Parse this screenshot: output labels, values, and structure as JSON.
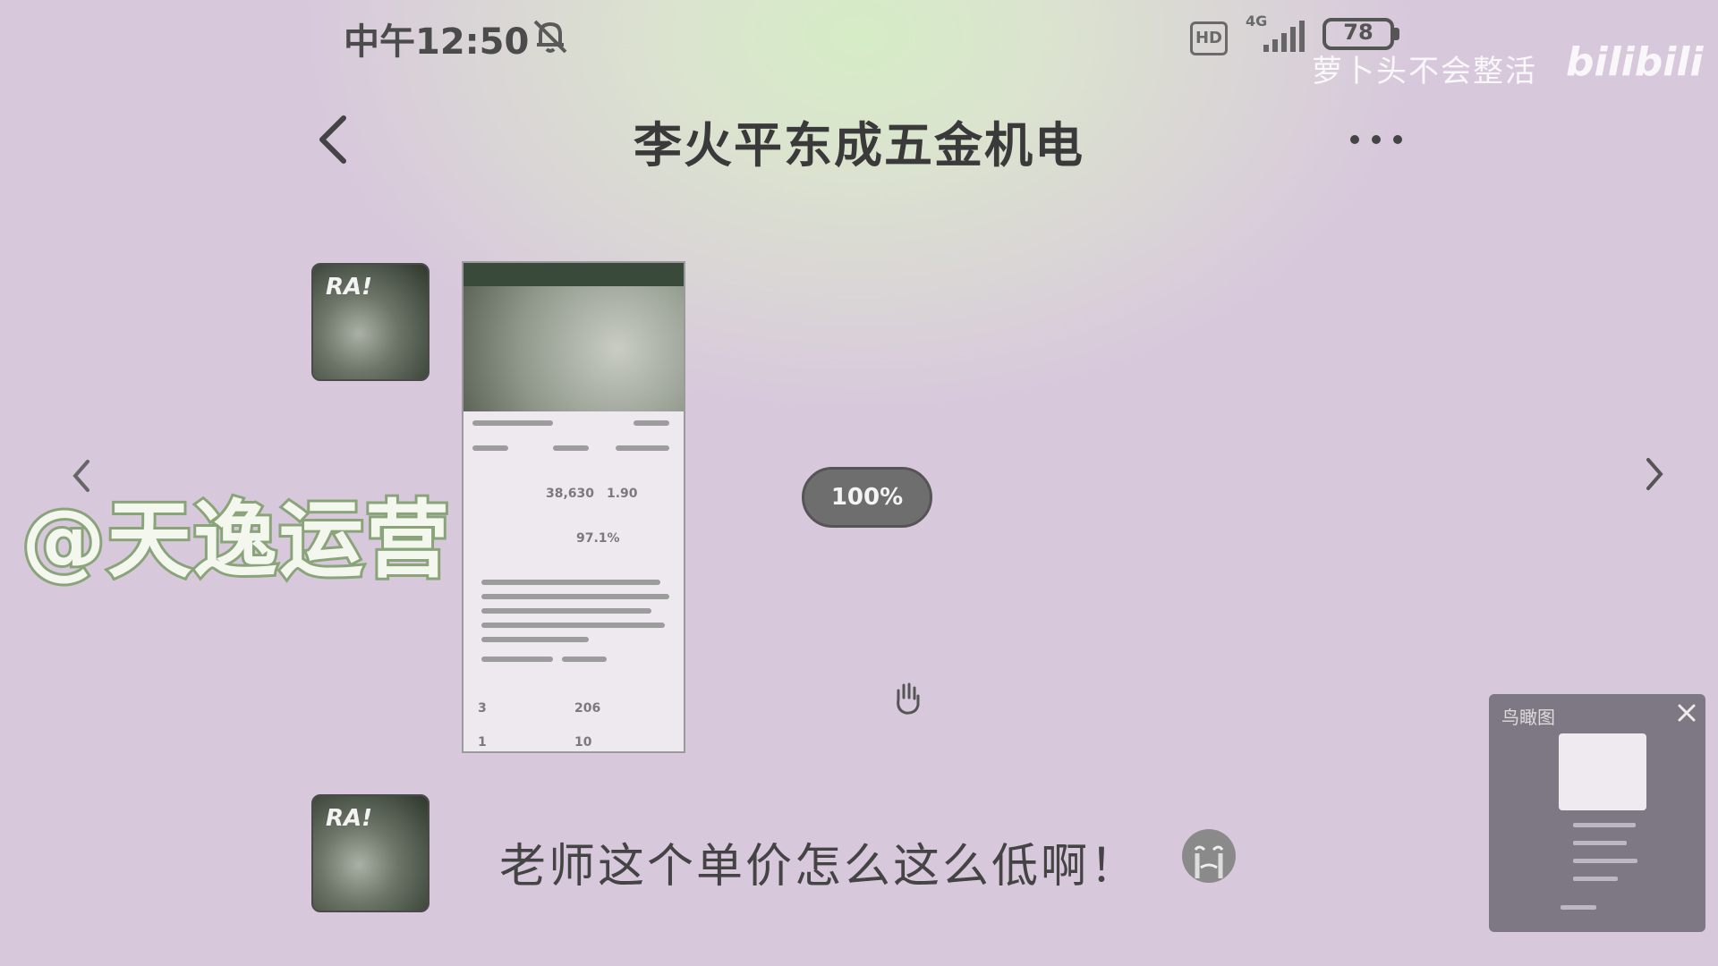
{
  "status_bar": {
    "time": "中午12:50",
    "hd_label": "HD",
    "network_label": "4G",
    "battery_level": "78"
  },
  "watermark": {
    "text": "萝卜头不会整活",
    "logo": "bilibili"
  },
  "header": {
    "title": "李火平东成五金机电"
  },
  "avatar_text": "RA!",
  "screenshot_thumb": {
    "stats": [
      "38,630",
      "1.90",
      "97.1%",
      "3",
      "206",
      "1",
      "10"
    ]
  },
  "viewer": {
    "zoom_label": "100%"
  },
  "overlay_handle": "@天逸运营",
  "message": {
    "text": "老师这个单价怎么这么低啊！"
  },
  "mini_panel": {
    "title": "鸟瞰图"
  },
  "icons": {
    "back": "chevron-left-icon",
    "more": "more-dots-icon",
    "nav_left": "chevron-left-icon",
    "nav_right": "chevron-right-icon",
    "bell_off": "bell-off-icon",
    "hand": "hand-cursor-icon",
    "emoji": "emoji-icon",
    "close": "close-icon"
  },
  "colors": {
    "background": "#d8c8dc",
    "highlight": "#d6ecc6",
    "pill": "#6e6e6e",
    "handle_stroke": "#8aa47a"
  }
}
